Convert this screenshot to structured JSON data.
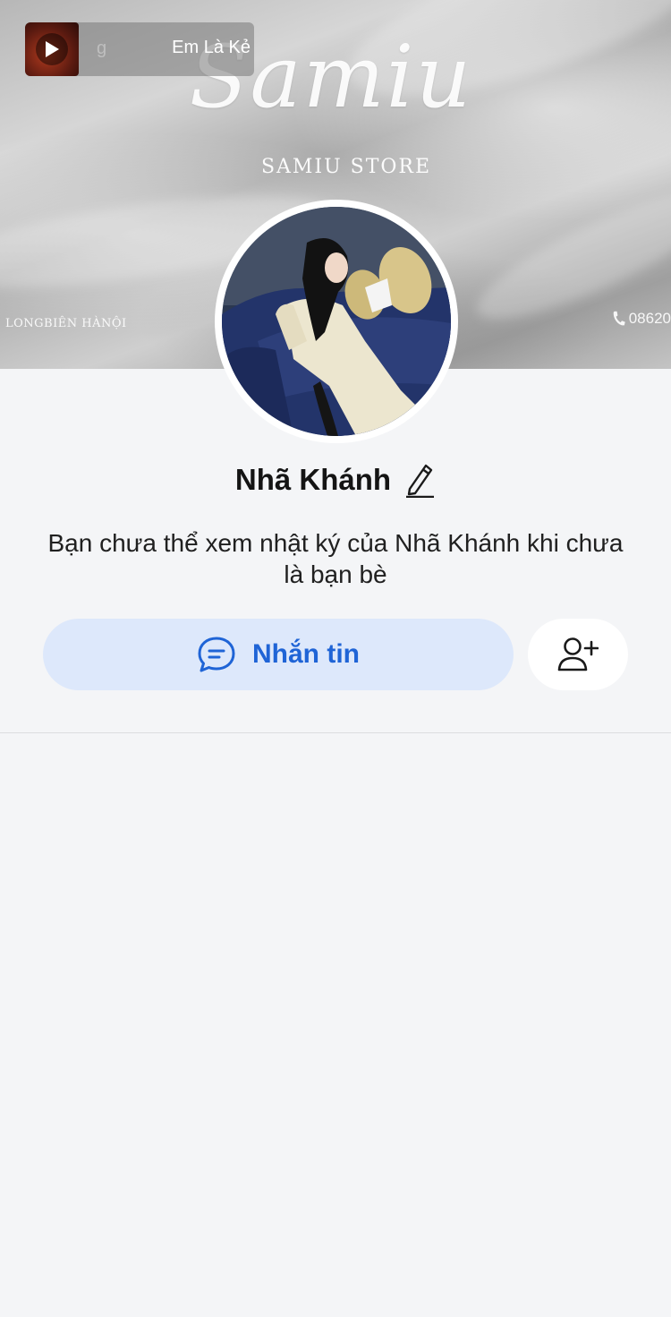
{
  "cover": {
    "brand_script": "Samiu",
    "store_name": "SAMIU STORE",
    "location": "LONGBIÊN HÀNỘI",
    "phone_fragment": "08620"
  },
  "music": {
    "title_prefix": "g",
    "title": "Em Là Kẻ",
    "icons": {
      "play": "play-icon"
    }
  },
  "profile": {
    "name": "Nhã Khánh",
    "notice": "Bạn chưa thể xem nhật ký của Nhã Khánh khi chưa là bạn bè"
  },
  "actions": {
    "message_label": "Nhắn tin",
    "icons": {
      "message": "chat-bubble-icon",
      "add_friend": "add-friend-icon",
      "edit": "pencil-icon"
    }
  },
  "colors": {
    "accent": "#1f64d6",
    "message_bg": "#dde8fb",
    "page_bg": "#f4f5f7"
  }
}
